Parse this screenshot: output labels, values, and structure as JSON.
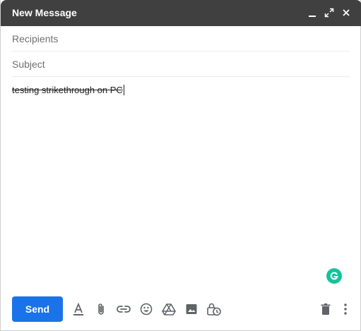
{
  "window": {
    "title": "New Message"
  },
  "fields": {
    "recipients_placeholder": "Recipients",
    "recipients_value": "",
    "subject_placeholder": "Subject",
    "subject_value": ""
  },
  "body": {
    "text": "testing strikethrough on PC",
    "style": "strikethrough"
  },
  "toolbar": {
    "send_label": "Send",
    "icons": [
      "formatting-options-icon",
      "attach-file-icon",
      "insert-link-icon",
      "insert-emoji-icon",
      "google-drive-icon",
      "insert-photo-icon",
      "confidential-mode-icon",
      "discard-draft-icon",
      "more-options-icon"
    ]
  },
  "colors": {
    "titlebar": "#404040",
    "send_button": "#1a73e8",
    "grammarly": "#15c39a",
    "icon": "#5f6368"
  }
}
